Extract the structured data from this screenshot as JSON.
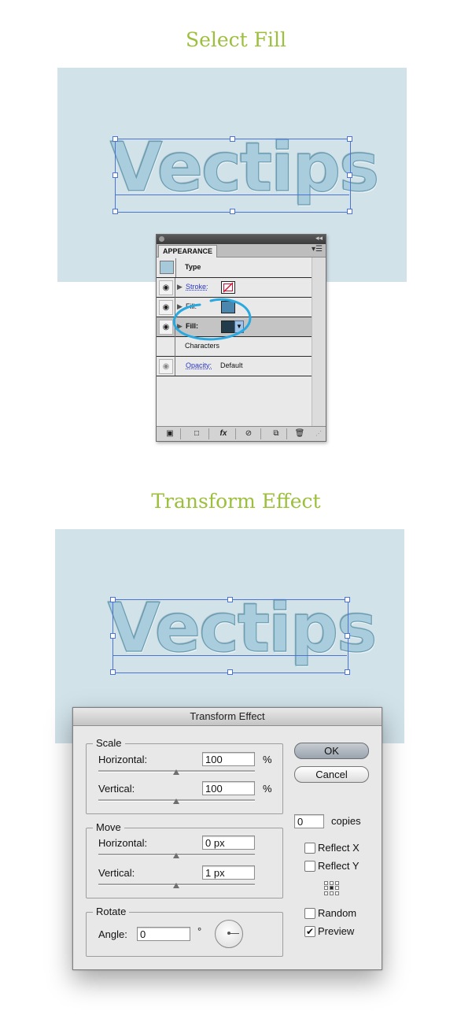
{
  "sections": {
    "select_fill_title": "Select Fill",
    "transform_effect_title": "Transform Effect"
  },
  "artwork": {
    "word": "Vectips",
    "colors": {
      "background": "#d1e2e9",
      "text": "#a9cddc",
      "selection": "#4d74d4",
      "heading": "#9cbf3c"
    }
  },
  "appearance_panel": {
    "tab": "APPEARANCE",
    "header": {
      "label": "Type",
      "swatch": "#a6cad9"
    },
    "rows": [
      {
        "label": "Stroke:",
        "swatch": "none"
      },
      {
        "label": "Fill:",
        "swatch": "#4a86ad"
      },
      {
        "label": "Fill:",
        "swatch": "#233c4b",
        "selected": true
      },
      {
        "label": "Characters"
      },
      {
        "label": "Opacity:",
        "value": "Default"
      }
    ],
    "highlight_circle_color": "#29a9e0",
    "bottom_buttons": [
      "new-art-icon",
      "clear-icon",
      "fx-icon",
      "no-icon",
      "duplicate-icon",
      "trash-icon"
    ]
  },
  "transform_dialog": {
    "title": "Transform Effect",
    "scale": {
      "label": "Scale",
      "horizontal_label": "Horizontal:",
      "horizontal": "100",
      "vertical_label": "Vertical:",
      "vertical": "100",
      "unit": "%"
    },
    "move": {
      "label": "Move",
      "horizontal_label": "Horizontal:",
      "horizontal": "0 px",
      "vertical_label": "Vertical:",
      "vertical": "1 px"
    },
    "rotate": {
      "label": "Rotate",
      "angle_label": "Angle:",
      "angle": "0",
      "degree": "°"
    },
    "ok": "OK",
    "cancel": "Cancel",
    "copies_value": "0",
    "copies_label": "copies",
    "reflect_x": "Reflect X",
    "reflect_y": "Reflect Y",
    "random": "Random",
    "preview": "Preview",
    "preview_checked": true
  }
}
